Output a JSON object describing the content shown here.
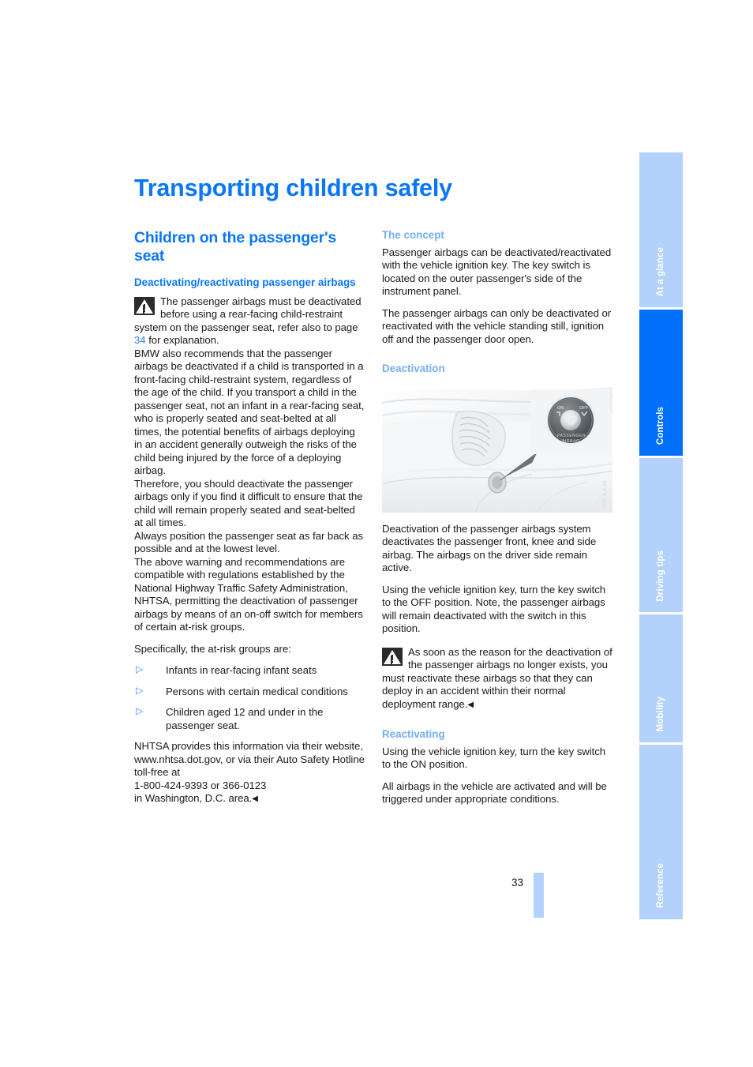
{
  "document": {
    "chapter_title": "Transporting children safely",
    "page_number": "33",
    "figure_code": "VCC-2-3-03"
  },
  "left_column": {
    "section_heading": "Children on the passenger's seat",
    "sub_heading": "Deactivating/reactivating passenger airbags",
    "warning": {
      "icon": "warning-triangle-icon",
      "text_before_link": "The passenger airbags must be deactivated before using a rear-facing child-restraint system on the passenger seat, refer also to page ",
      "page_link": "34",
      "text_after_link": " for explanation."
    },
    "paragraphs": [
      "BMW also recommends that the passenger airbags be deactivated if a child is transported in a front-facing child-restraint system, regardless of the age of the child. If you transport a child in the passenger seat, not an infant in a rear-facing seat, who is properly seated and seat-belted at all times, the potential benefits of airbags deploying in an accident generally outweigh the risks of the child being injured by the force of a deploying airbag.",
      "Therefore, you should deactivate the passenger airbags only if you find it difficult to ensure that the child will remain properly seated and seat-belted at all times.",
      "Always position the passenger seat as far back as possible and at the lowest level.",
      "The above warning and recommendations are compatible with regulations established by the National Highway Traffic Safety Administration, NHTSA, permitting the deactivation of passenger airbags by means of an on-off switch for members of certain at-risk groups."
    ],
    "list_intro": "Specifically, the at-risk groups are:",
    "bullets": [
      "Infants in rear-facing infant seats",
      "Persons with certain medical conditions",
      "Children aged 12 and under in the passenger seat."
    ],
    "closing_paragraph": "NHTSA provides this information via their website, www.nhtsa.dot.gov, or via their Auto Safety Hotline toll-free at",
    "closing_phone": "1-800-424-9393 or 366-0123",
    "closing_location": "in Washington, D.C. area.",
    "end_mark": "◀"
  },
  "right_column": {
    "concept": {
      "heading": "The concept",
      "paragraphs": [
        "Passenger airbags can be deactivated/reactivated with the vehicle ignition key. The key switch is located on the outer passenger's side of the instrument panel.",
        "The passenger airbags can only be deactivated or reactivated with the vehicle standing still, ignition off and the passenger door open."
      ]
    },
    "deactivation": {
      "heading": "Deactivation",
      "figure_alt": "instrument-panel-key-switch-illustration",
      "paragraphs": [
        "Deactivation of the passenger airbags system deactivates the passenger front, knee and side airbag. The airbags on the driver side remain active.",
        "Using the vehicle ignition key, turn the key switch to the OFF position. Note, the passenger airbags will remain deactivated with the switch in this position."
      ],
      "warning": {
        "icon": "warning-triangle-icon",
        "text": "As soon as the reason for the deactivation of the passenger airbags no longer exists, you must reactivate these airbags so that they can deploy in an accident within their normal deployment range.",
        "end_mark": "◀"
      }
    },
    "reactivating": {
      "heading": "Reactivating",
      "paragraphs": [
        "Using the vehicle ignition key, turn the key switch to the ON position.",
        "All airbags in the vehicle are activated and will be triggered under appropriate conditions."
      ]
    }
  },
  "side_tabs": {
    "items": [
      {
        "label": "At a glance",
        "active": false
      },
      {
        "label": "Controls",
        "active": true
      },
      {
        "label": "Driving tips",
        "active": false
      },
      {
        "label": "Mobility",
        "active": false
      },
      {
        "label": "Reference",
        "active": false
      }
    ]
  },
  "colors": {
    "heading_blue": "#0a76f6",
    "subheading_light_blue": "#74aef4",
    "tab_active": "#0070fb",
    "tab_inactive": "#b3d2fb",
    "link_blue": "#2d7ff9"
  }
}
